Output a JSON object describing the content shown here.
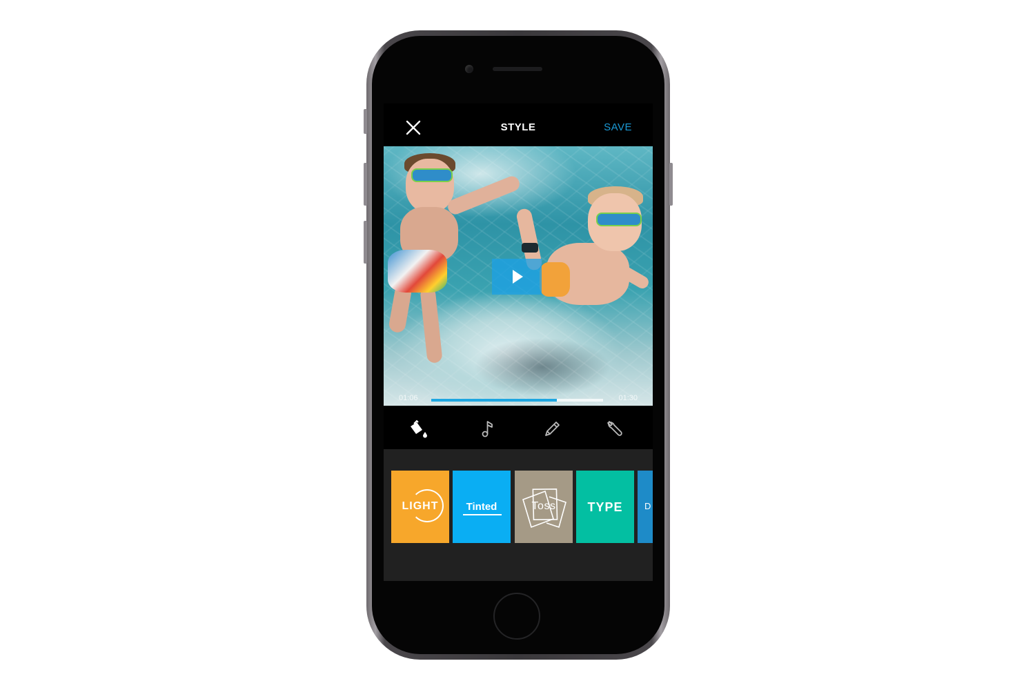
{
  "device": {
    "type": "smartphone"
  },
  "header": {
    "title": "STYLE",
    "save_label": "SAVE",
    "accent_color": "#1b9ad6"
  },
  "player": {
    "current_time": "01:06",
    "end_time": "01:30",
    "progress": 0.73,
    "progress_color": "#1ea7e1"
  },
  "toolbar": {
    "tools": [
      {
        "icon": "paint-bucket-icon",
        "label": "Style",
        "active": true
      },
      {
        "icon": "music-note-icon",
        "label": "Music",
        "active": false
      },
      {
        "icon": "pencil-icon",
        "label": "Edit",
        "active": false
      },
      {
        "icon": "wrench-icon",
        "label": "Settings",
        "active": false
      }
    ]
  },
  "styles": [
    {
      "label": "LIGHT",
      "color": "#f7a72b"
    },
    {
      "label": "Tinted",
      "color": "#0aaef3"
    },
    {
      "label": "Toss",
      "color": "#a59a86"
    },
    {
      "label": "TYPE",
      "color": "#03bfa2"
    },
    {
      "label": "D",
      "color": "#1e8bc8"
    }
  ]
}
